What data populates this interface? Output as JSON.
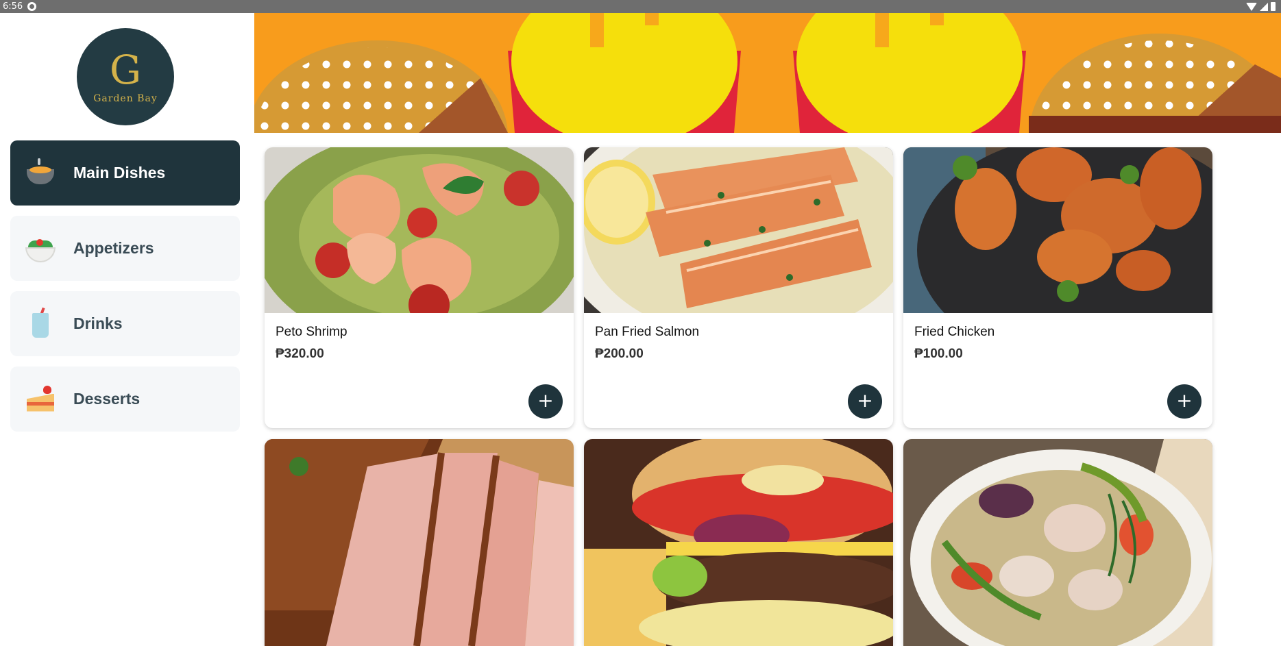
{
  "status_bar": {
    "time": "6:56",
    "icons": [
      "settings-icon",
      "wifi-icon",
      "signal-icon",
      "battery-icon"
    ]
  },
  "brand": {
    "logo_text": "Garden Bay",
    "logo_mark": "G"
  },
  "categories": [
    {
      "label": "Main Dishes",
      "icon": "pot-icon",
      "active": true
    },
    {
      "label": "Appetizers",
      "icon": "salad-bowl-icon",
      "active": false
    },
    {
      "label": "Drinks",
      "icon": "drink-cup-icon",
      "active": false
    },
    {
      "label": "Desserts",
      "icon": "cake-slice-icon",
      "active": false
    }
  ],
  "menu_items": [
    {
      "name": "Peto Shrimp",
      "price": "₱320.00",
      "image": "shrimp-pesto-pasta",
      "add_label": "+"
    },
    {
      "name": "Pan Fried Salmon",
      "price": "₱200.00",
      "image": "pan-fried-salmon",
      "add_label": "+"
    },
    {
      "name": "Fried Chicken",
      "price": "₱100.00",
      "image": "fried-chicken",
      "add_label": "+"
    },
    {
      "name": "",
      "price": "",
      "image": "sliced-roast-pork",
      "add_label": ""
    },
    {
      "name": "",
      "price": "",
      "image": "cheeseburger",
      "add_label": ""
    },
    {
      "name": "",
      "price": "",
      "image": "sinigang-soup",
      "add_label": ""
    }
  ],
  "colors": {
    "accent_dark": "#1f343c",
    "banner_orange": "#f89c1c",
    "banner_yellow": "#f5df0c",
    "banner_red": "#e0243a",
    "banner_tan": "#d69a34"
  }
}
